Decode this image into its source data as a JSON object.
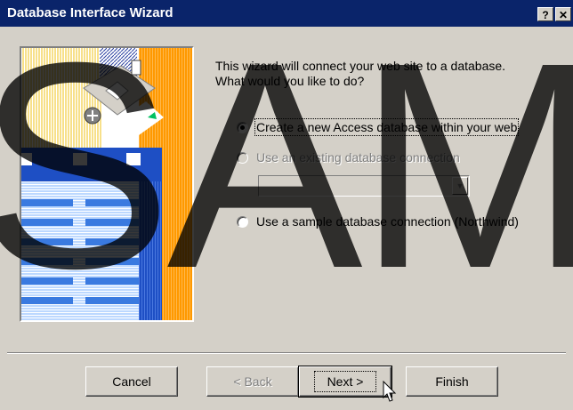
{
  "window": {
    "title": "Database Interface Wizard",
    "help_button": "?",
    "close_button": "✕"
  },
  "intro": {
    "line1": "This wizard will connect your web site to a database.",
    "line2": "What would you like to do?"
  },
  "options": {
    "create_new": {
      "label": "Create a new Access database within your web",
      "selected": true,
      "enabled": true
    },
    "use_existing": {
      "label": "Use an existing database connection",
      "selected": false,
      "enabled": false
    },
    "use_sample": {
      "label": "Use a sample database connection (Northwind)",
      "selected": false,
      "enabled": true
    }
  },
  "connection_select": {
    "value": "",
    "enabled": false
  },
  "buttons": {
    "cancel": "Cancel",
    "back": "< Back",
    "next": "Next >",
    "finish": "Finish"
  },
  "watermark": {
    "text": "SAM"
  },
  "colors": {
    "titlebar": "#0a246a",
    "face": "#d4d0c8",
    "art_blue": "#1e4fc4",
    "art_orange": "#ff9900",
    "art_yellow": "#f7e08a"
  }
}
